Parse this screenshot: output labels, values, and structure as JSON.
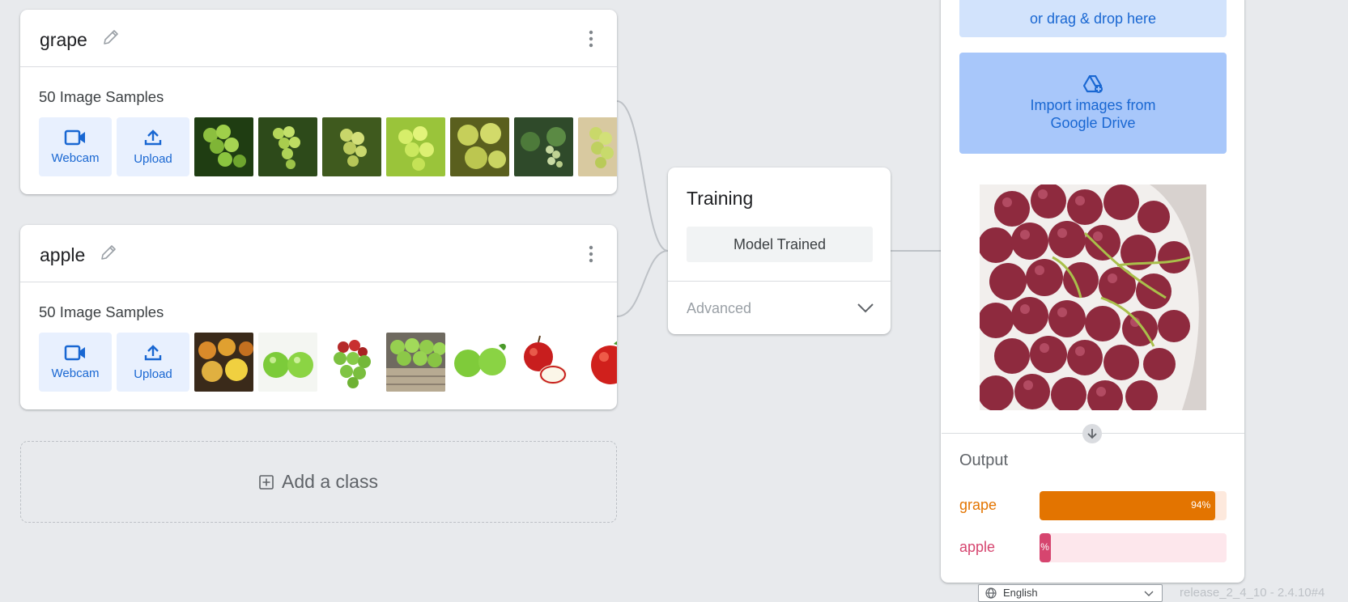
{
  "classes": [
    {
      "name": "grape",
      "samples_label": "50 Image Samples",
      "webcam_label": "Webcam",
      "upload_label": "Upload"
    },
    {
      "name": "apple",
      "samples_label": "50 Image Samples",
      "webcam_label": "Webcam",
      "upload_label": "Upload"
    }
  ],
  "add_class_label": "Add a class",
  "training": {
    "title": "Training",
    "button_label": "Model Trained",
    "advanced_label": "Advanced"
  },
  "preview": {
    "drag_drop_label": "or drag & drop here",
    "gdrive_label": "Import images from Google Drive",
    "output_title": "Output",
    "results": [
      {
        "label": "grape",
        "percent_text": "94%",
        "value": 0.94,
        "color": "#e37400",
        "track_color": "#fde9dd"
      },
      {
        "label": "apple",
        "percent_text": "%",
        "value": 0.06,
        "color": "#d6456f",
        "track_color": "#fde7ec"
      }
    ]
  },
  "footer": {
    "language": "English",
    "release": "release_2_4_10 - 2.4.10#4"
  },
  "colors": {
    "accent": "#1967d2",
    "background": "#e8eaed"
  }
}
